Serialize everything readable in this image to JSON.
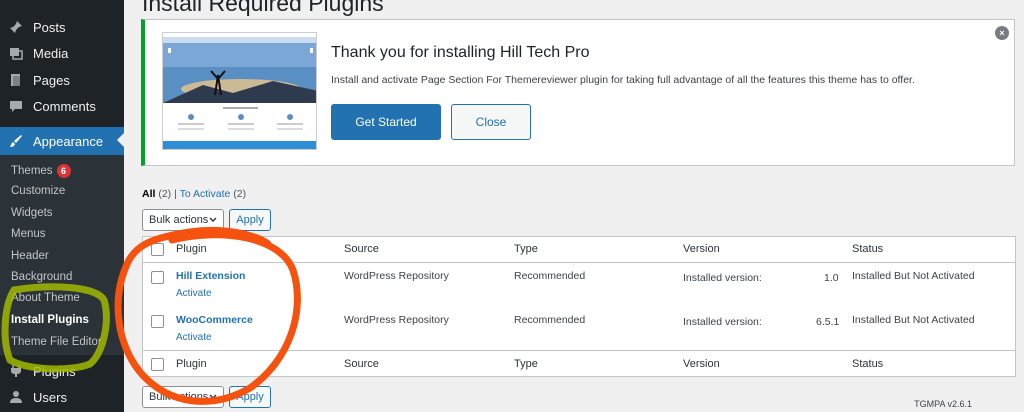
{
  "sidebar": {
    "items": [
      {
        "label": "Posts",
        "icon": "pin-icon"
      },
      {
        "label": "Media",
        "icon": "media-icon"
      },
      {
        "label": "Pages",
        "icon": "page-icon"
      },
      {
        "label": "Comments",
        "icon": "comment-icon"
      },
      {
        "label": "Appearance",
        "icon": "brush-icon"
      },
      {
        "label": "Plugins",
        "icon": "plug-icon"
      },
      {
        "label": "Users",
        "icon": "user-icon"
      }
    ],
    "submenu": {
      "themes": "Themes",
      "themes_badge": "6",
      "customize": "Customize",
      "widgets": "Widgets",
      "menus": "Menus",
      "header": "Header",
      "background": "Background",
      "about_theme": "About Theme",
      "install_plugins": "Install Plugins",
      "theme_file_editor": "Theme File Editor"
    }
  },
  "page_title": "Install Required Plugins",
  "notice": {
    "title": "Thank you for installing Hill Tech Pro",
    "description": "Install and activate Page Section For Themereviewer plugin for taking full advantage of all the features this theme has to offer.",
    "get_started": "Get Started",
    "close": "Close",
    "dismiss": "×"
  },
  "filters": {
    "all": "All",
    "all_count": "(2)",
    "separator": "|",
    "to_activate": "To Activate",
    "to_activate_count": "(2)"
  },
  "bulk": {
    "label": "Bulk actions",
    "apply": "Apply"
  },
  "table": {
    "headers": [
      "Plugin",
      "Source",
      "Type",
      "Version",
      "Status"
    ],
    "rows": [
      {
        "plugin": "Hill Extension",
        "action": "Activate",
        "source": "WordPress Repository",
        "type": "Recommended",
        "version_label": "Installed version:",
        "version": "1.0",
        "status": "Installed But Not Activated"
      },
      {
        "plugin": "WooCommerce",
        "action": "Activate",
        "source": "WordPress Repository",
        "type": "Recommended",
        "version_label": "Installed version:",
        "version": "6.5.1",
        "status": "Installed But Not Activated"
      }
    ]
  },
  "footer": {
    "version": "TGMPA v2.6.1"
  },
  "colors": {
    "sidebar_bg": "#1d2327",
    "accent": "#2271b1",
    "notice_border": "#00a32a",
    "badge": "#d63638",
    "annotation_orange": "#f5520f",
    "annotation_green": "#a0b800"
  }
}
